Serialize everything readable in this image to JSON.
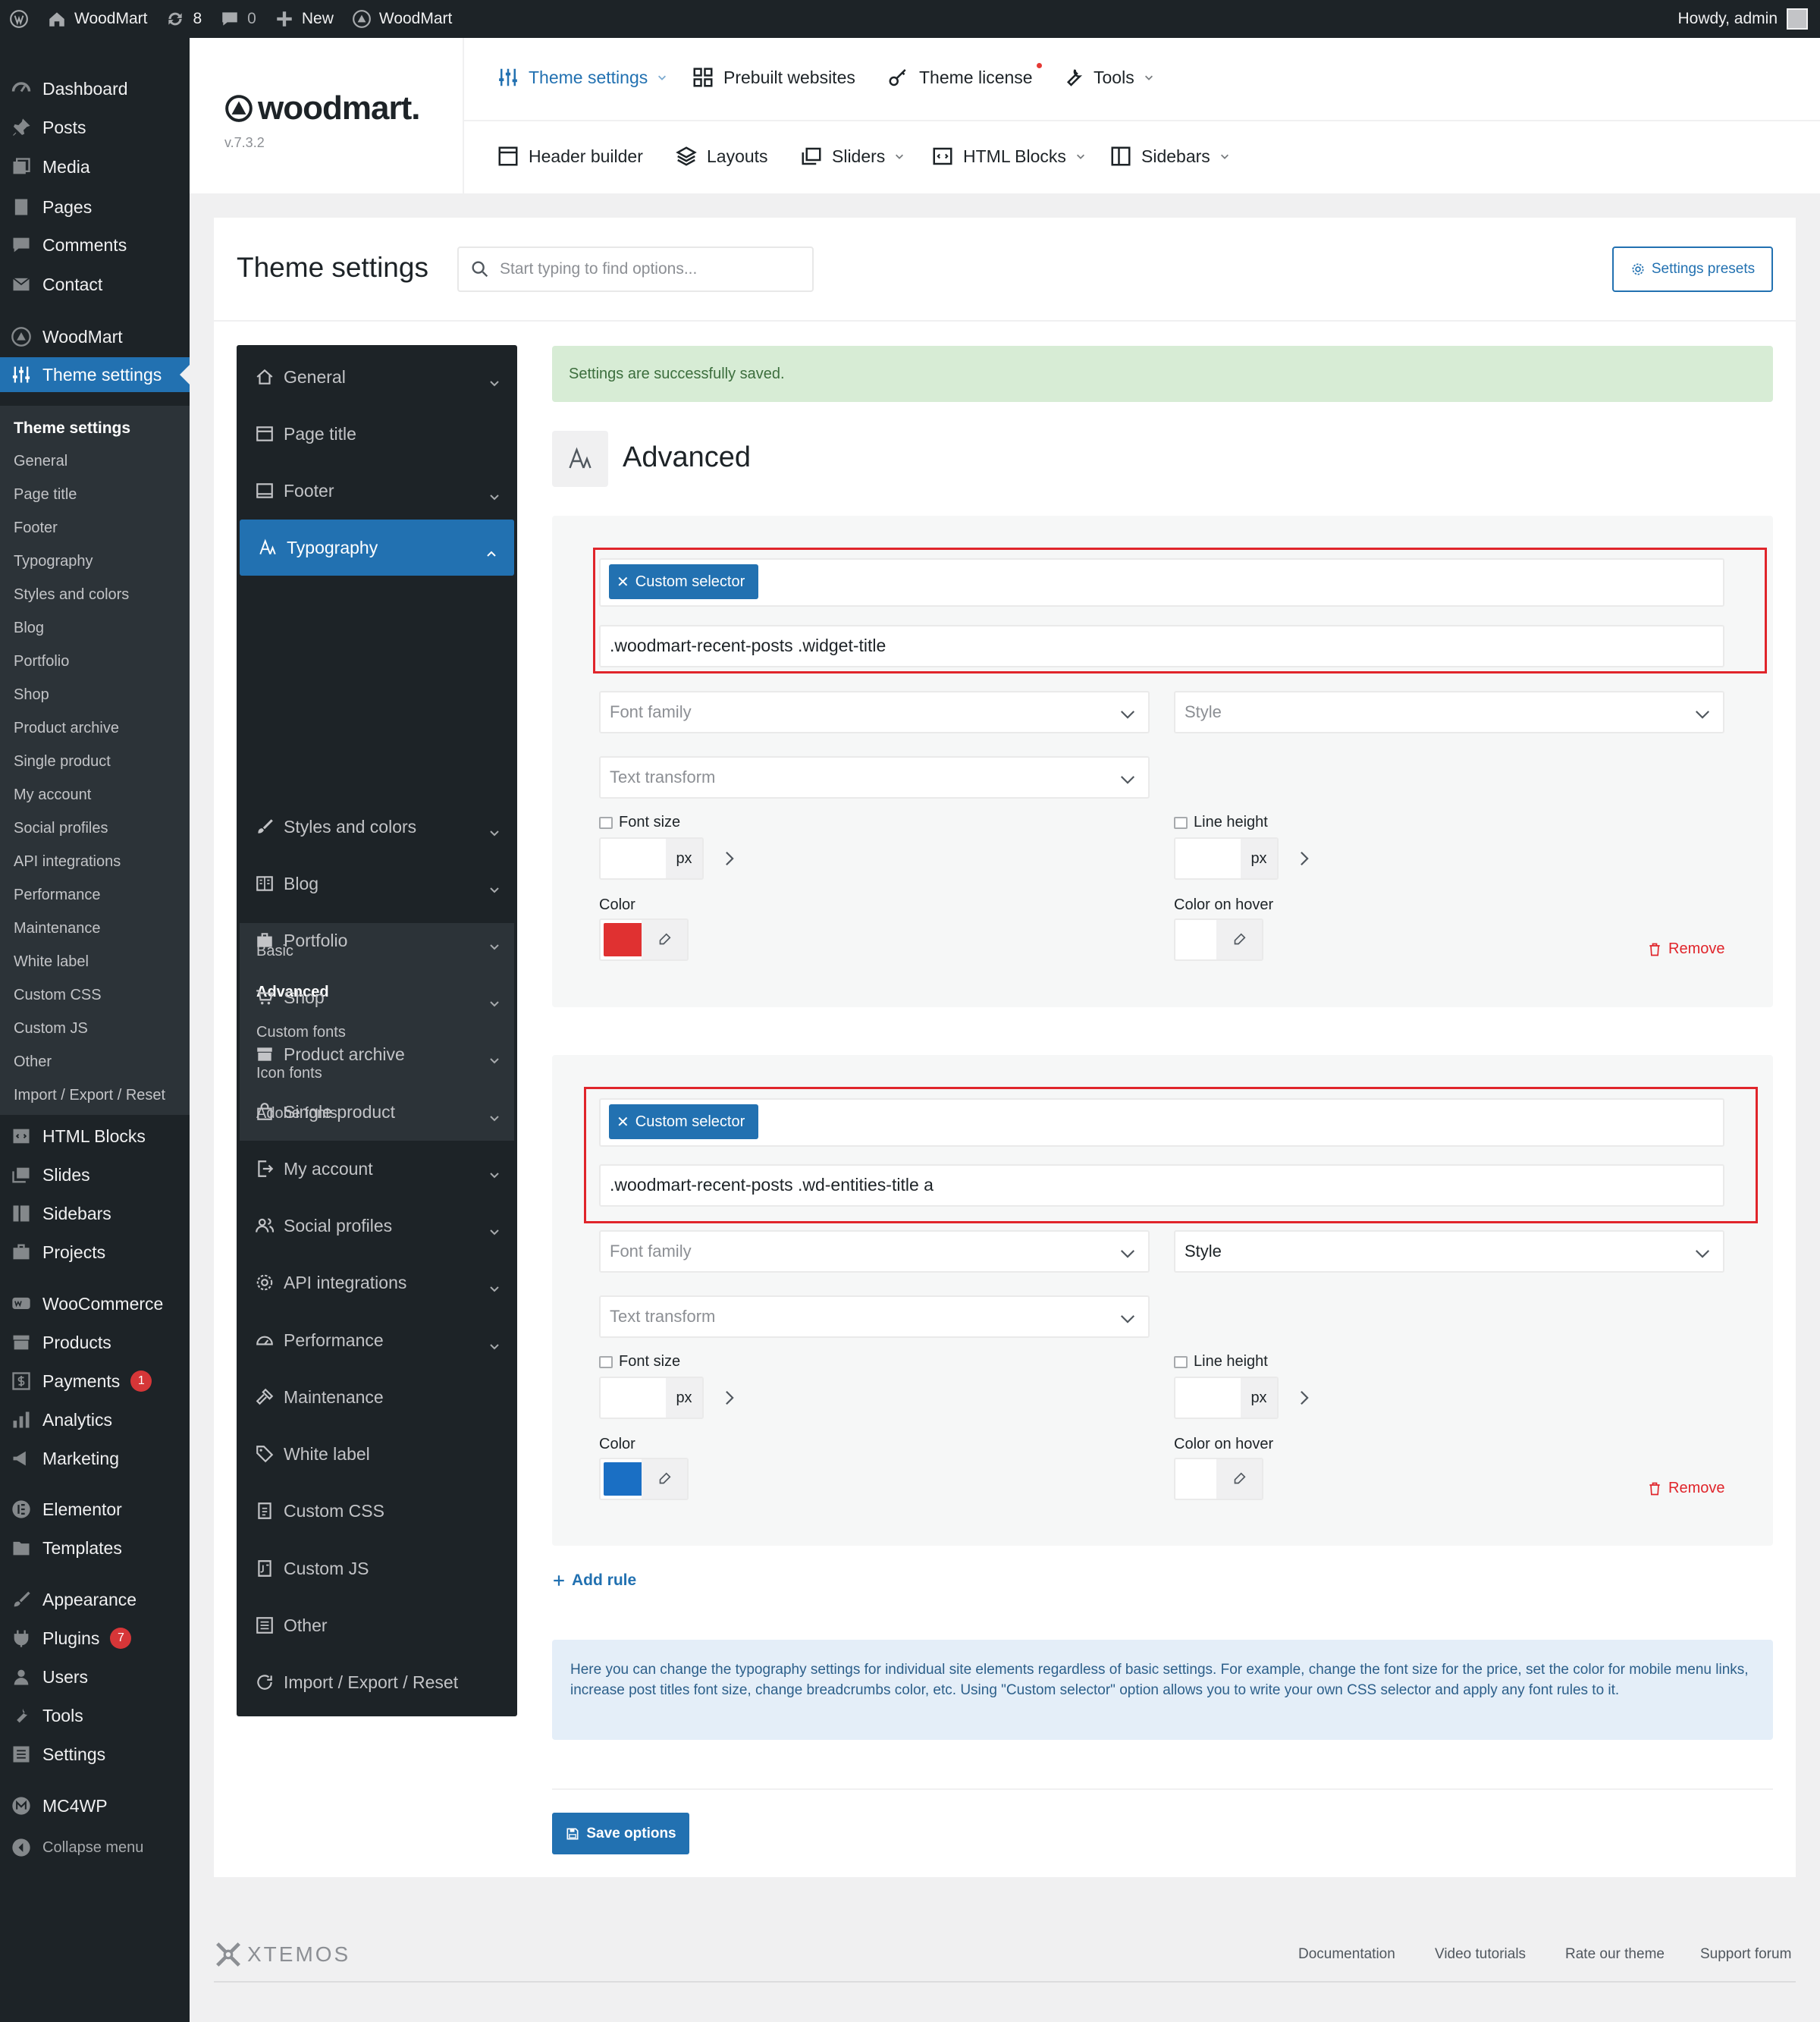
{
  "admin_bar": {
    "site_name": "WoodMart",
    "updates_count": "8",
    "comments_count": "0",
    "new_label": "New",
    "theme_label": "WoodMart",
    "greeting": "Howdy, admin"
  },
  "admin_menu": {
    "items": [
      {
        "label": "Dashboard",
        "icon": "dashboard-icon"
      },
      {
        "label": "Posts",
        "icon": "pin-icon"
      },
      {
        "label": "Media",
        "icon": "media-icon"
      },
      {
        "label": "Pages",
        "icon": "pages-icon"
      },
      {
        "label": "Comments",
        "icon": "comment-icon"
      },
      {
        "label": "Contact",
        "icon": "mail-icon"
      },
      {
        "label": "WoodMart",
        "icon": "woodmart-icon"
      },
      {
        "label": "Theme settings",
        "icon": "sliders-icon",
        "current": true
      },
      {
        "label": "Layouts",
        "icon": "layers-icon"
      },
      {
        "label": "HTML Blocks",
        "icon": "html-icon"
      },
      {
        "label": "Slides",
        "icon": "slides-icon"
      },
      {
        "label": "Sidebars",
        "icon": "sidebar-icon"
      },
      {
        "label": "Projects",
        "icon": "briefcase-icon"
      },
      {
        "label": "WooCommerce",
        "icon": "woo-icon"
      },
      {
        "label": "Products",
        "icon": "archive-icon"
      },
      {
        "label": "Payments",
        "icon": "dollar-icon",
        "badge": "1"
      },
      {
        "label": "Analytics",
        "icon": "bar-chart-icon"
      },
      {
        "label": "Marketing",
        "icon": "megaphone-icon"
      },
      {
        "label": "Elementor",
        "icon": "elementor-icon"
      },
      {
        "label": "Templates",
        "icon": "folder-icon"
      },
      {
        "label": "Appearance",
        "icon": "brush-icon"
      },
      {
        "label": "Plugins",
        "icon": "plug-icon",
        "badge": "7"
      },
      {
        "label": "Users",
        "icon": "user-icon"
      },
      {
        "label": "Tools",
        "icon": "wrench-icon"
      },
      {
        "label": "Settings",
        "icon": "settings-icon"
      },
      {
        "label": "MC4WP",
        "icon": "mc4wp-icon"
      },
      {
        "label": "Collapse menu",
        "icon": "collapse-icon"
      }
    ],
    "submenu": [
      "Theme settings",
      "General",
      "Page title",
      "Footer",
      "Typography",
      "Styles and colors",
      "Blog",
      "Portfolio",
      "Shop",
      "Product archive",
      "Single product",
      "My account",
      "Social profiles",
      "API integrations",
      "Performance",
      "Maintenance",
      "White label",
      "Custom CSS",
      "Custom JS",
      "Other",
      "Import / Export / Reset"
    ]
  },
  "theme_header": {
    "logo_text": "woodmart.",
    "version": "v.7.3.2",
    "top_nav": [
      {
        "label": "Theme settings",
        "icon": "sliders-icon",
        "dropdown": true,
        "active": true
      },
      {
        "label": "Prebuilt websites",
        "icon": "grid-icon"
      },
      {
        "label": "Theme license",
        "icon": "key-icon",
        "dot": true
      },
      {
        "label": "Tools",
        "icon": "wrench-icon",
        "dropdown": true
      }
    ],
    "sub_nav": [
      {
        "label": "Header builder",
        "icon": "header-icon"
      },
      {
        "label": "Layouts",
        "icon": "layers-icon"
      },
      {
        "label": "Sliders",
        "icon": "slides-icon",
        "dropdown": true
      },
      {
        "label": "HTML Blocks",
        "icon": "html-icon",
        "dropdown": true
      },
      {
        "label": "Sidebars",
        "icon": "sidebar-icon",
        "dropdown": true
      }
    ]
  },
  "panel": {
    "title": "Theme settings",
    "search_placeholder": "Start typing to find options...",
    "presets_button": "Settings presets"
  },
  "settings_nav": {
    "items": [
      {
        "label": "General",
        "icon": "home-icon",
        "chevron": "down"
      },
      {
        "label": "Page title",
        "icon": "page-title-icon"
      },
      {
        "label": "Footer",
        "icon": "footer-icon",
        "chevron": "down"
      },
      {
        "label": "Typography",
        "icon": "typography-icon",
        "chevron": "up",
        "open": true
      },
      {
        "label": "Styles and colors",
        "icon": "brush-icon",
        "chevron": "down"
      },
      {
        "label": "Blog",
        "icon": "blog-icon",
        "chevron": "down"
      },
      {
        "label": "Portfolio",
        "icon": "briefcase-icon",
        "chevron": "down"
      },
      {
        "label": "Shop",
        "icon": "cart-icon",
        "chevron": "down"
      },
      {
        "label": "Product archive",
        "icon": "archive-icon",
        "chevron": "down"
      },
      {
        "label": "Single product",
        "icon": "bag-icon",
        "chevron": "down"
      },
      {
        "label": "My account",
        "icon": "account-icon",
        "chevron": "down"
      },
      {
        "label": "Social profiles",
        "icon": "users-icon",
        "chevron": "down"
      },
      {
        "label": "API integrations",
        "icon": "gear-icon",
        "chevron": "down"
      },
      {
        "label": "Performance",
        "icon": "gauge-icon",
        "chevron": "down"
      },
      {
        "label": "Maintenance",
        "icon": "hammer-icon"
      },
      {
        "label": "White label",
        "icon": "tag-icon"
      },
      {
        "label": "Custom CSS",
        "icon": "css-icon"
      },
      {
        "label": "Custom JS",
        "icon": "js-icon"
      },
      {
        "label": "Other",
        "icon": "other-icon"
      },
      {
        "label": "Import / Export / Reset",
        "icon": "refresh-icon"
      }
    ],
    "typography_sub": [
      {
        "label": "Basic"
      },
      {
        "label": "Advanced",
        "active": true
      },
      {
        "label": "Custom fonts"
      },
      {
        "label": "Icon fonts"
      },
      {
        "label": "Adobe fonts"
      }
    ]
  },
  "content": {
    "notice": "Settings are successfully saved.",
    "section_title": "Advanced",
    "rules": [
      {
        "chip": "Custom selector",
        "selector": ".woodmart-recent-posts .widget-title",
        "font_family_placeholder": "Font family",
        "style_value": "Style",
        "text_transform_placeholder": "Text transform",
        "font_size_label": "Font size",
        "line_height_label": "Line height",
        "unit": "px",
        "color_label": "Color",
        "color_value": "#e03131",
        "color_hover_label": "Color on hover",
        "remove_label": "Remove"
      },
      {
        "chip": "Custom selector",
        "selector": ".woodmart-recent-posts .wd-entities-title a",
        "font_family_placeholder": "Font family",
        "style_value": "Style",
        "text_transform_placeholder": "Text transform",
        "font_size_label": "Font size",
        "line_height_label": "Line height",
        "unit": "px",
        "color_label": "Color",
        "color_value": "#1a6fc4",
        "color_hover_label": "Color on hover",
        "remove_label": "Remove"
      }
    ],
    "add_rule": "Add rule",
    "info": "Here you can change the typography settings for individual site elements regardless of basic settings. For example, change the font size for the price, set the color for mobile menu links, increase post titles font size, change breadcrumbs color, etc. Using \"Custom selector\" option allows you to write your own CSS selector and apply any font rules to it.",
    "save_button": "Save options"
  },
  "footer": {
    "brand": "XTEMOS",
    "links": [
      "Documentation",
      "Video tutorials",
      "Rate our theme",
      "Support forum"
    ]
  },
  "colors": {
    "accent": "#2271b1",
    "admin_dark": "#1d2327",
    "highlight_red": "#e0252b",
    "notice_green": "#d7ecd5"
  }
}
